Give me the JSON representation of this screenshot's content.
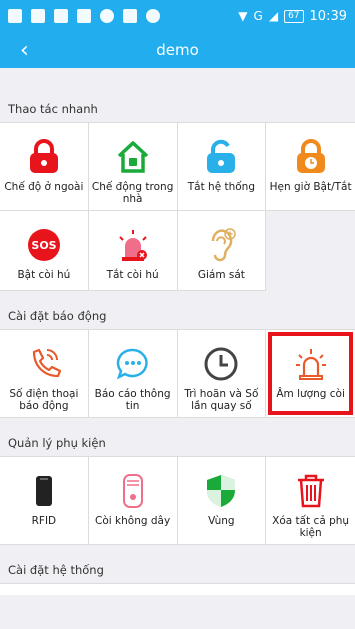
{
  "status": {
    "time": "10:39",
    "battery": "67",
    "network": "G"
  },
  "header": {
    "title": "demo",
    "back": "‹"
  },
  "sections": [
    {
      "title": "Thao tác nhanh",
      "items": [
        {
          "label": "Chế độ ở ngoài"
        },
        {
          "label": "Chế động trong nhà"
        },
        {
          "label": "Tắt hệ thống"
        },
        {
          "label": "Hẹn giờ Bật/Tắt"
        },
        {
          "label": "Bật còi hú"
        },
        {
          "label": "Tắt còi hú"
        },
        {
          "label": "Giám sát"
        }
      ]
    },
    {
      "title": "Cài đặt báo động",
      "items": [
        {
          "label": "Số điện thoại báo động"
        },
        {
          "label": "Báo cáo thông tin"
        },
        {
          "label": "Trì hoãn và Số lần quay số"
        },
        {
          "label": "Âm lượng còi"
        }
      ]
    },
    {
      "title": "Quản lý phụ kiện",
      "items": [
        {
          "label": "RFID"
        },
        {
          "label": "Còi không dây"
        },
        {
          "label": "Vùng"
        },
        {
          "label": "Xóa tất cả phụ kiện"
        }
      ]
    },
    {
      "title": "Cài đặt hệ thống"
    }
  ],
  "sos_text": "SOS",
  "colors": {
    "primary": "#22aeee",
    "red": "#e8141c",
    "orange": "#f08a1c",
    "green": "#1aaa3a",
    "blue": "#2ab0e8"
  }
}
